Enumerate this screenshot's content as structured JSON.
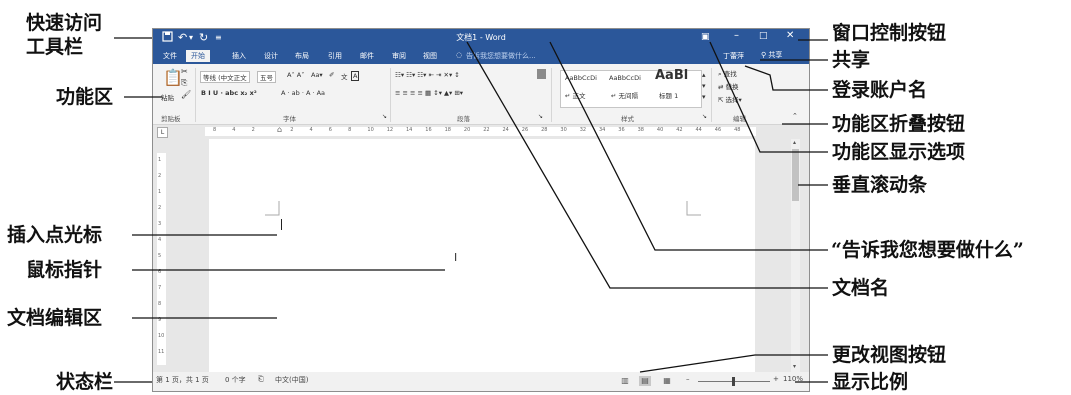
{
  "window": {
    "title": "文档1 - Word",
    "quick_access": {
      "save_icon": "save-icon",
      "undo_icon": "undo-icon",
      "redo_icon": "redo-icon",
      "customize_icon": "customize-icon"
    },
    "controls": {
      "ribbon_display": "ribbon-display-options-icon",
      "minimize": "minimize-icon",
      "restore": "restore-icon",
      "close": "close-icon"
    }
  },
  "tabs": [
    "文件",
    "开始",
    "插入",
    "设计",
    "布局",
    "引用",
    "邮件",
    "审阅",
    "视图"
  ],
  "active_tab": "开始",
  "tell_me": "告诉我您想要做什么...",
  "account": "丁蕾萍",
  "share": "共享",
  "ribbon": {
    "clipboard": {
      "paste": "粘贴",
      "group": "剪贴板"
    },
    "font": {
      "font_name": "等线 (中文正文",
      "font_size": "五号",
      "format_row": "B  I  U  ·  abc  x₂  x²",
      "color_row": "A · ab · A · Aa",
      "group": "字体"
    },
    "paragraph": {
      "group": "段落"
    },
    "styles": {
      "items": [
        {
          "sample": "AaBbCcDi",
          "name": "↵ 正文"
        },
        {
          "sample": "AaBbCcDi",
          "name": "↵ 无间隔"
        },
        {
          "sample": "AaBl",
          "name": "标题 1"
        }
      ],
      "group": "样式"
    },
    "editing": {
      "find": "查找",
      "replace": "替换",
      "select": "选择",
      "group": "编辑"
    }
  },
  "ruler": {
    "h_ticks": [
      "8",
      "4",
      "2",
      "",
      "2",
      "4",
      "6",
      "8",
      "10",
      "12",
      "14",
      "16",
      "18",
      "20",
      "22",
      "24",
      "26",
      "28",
      "30",
      "32",
      "34",
      "36",
      "38",
      "40",
      "42",
      "44",
      "46",
      "48"
    ],
    "v_ticks": [
      "1",
      "2",
      "1",
      "2",
      "3",
      "4",
      "5",
      "6",
      "7",
      "8",
      "9",
      "10",
      "11"
    ]
  },
  "status": {
    "page": "第 1 页，共 1 页",
    "words": "0 个字",
    "language": "中文(中国)",
    "zoom": "110%"
  },
  "annotations": {
    "quick_access": [
      "快速访问",
      "工具栏"
    ],
    "ribbon": "功能区",
    "insertion_point": "插入点光标",
    "mouse_pointer": "鼠标指针",
    "edit_area": "文档编辑区",
    "status_bar": "状态栏",
    "window_controls": "窗口控制按钮",
    "share": "共享",
    "account": "登录账户名",
    "collapse_ribbon": "功能区折叠按钮",
    "ribbon_options": "功能区显示选项",
    "vertical_scroll": "垂直滚动条",
    "tell_me": "“告诉我您想要做什么”",
    "doc_name": "文档名",
    "view_buttons": "更改视图按钮",
    "zoom_ratio": "显示比例"
  },
  "colors": {
    "title_bar": "#2b579a",
    "ribbon_bg": "#f3f3f3",
    "workspace": "#e7e7e7"
  }
}
